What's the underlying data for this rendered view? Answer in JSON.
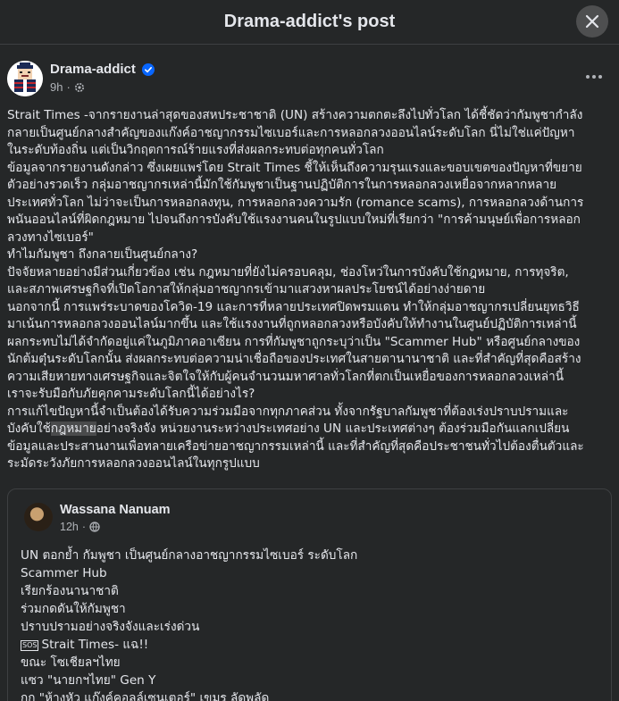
{
  "header": {
    "title": "Drama-addict's post"
  },
  "post": {
    "author": "Drama-addict",
    "time": "9h",
    "lines": [
      "Strait Times -จากรายงานล่าสุดของสหประชาชาติ (UN) สร้างความตกตะลึงไปทั่วโลก ได้ชี้ชัดว่ากัมพูชากำลัง",
      "กลายเป็นศูนย์กลางสำคัญของแก๊งค์อาชญากรรมไซเบอร์และการหลอกลวงออนไลน์ระดับโลก นี่ไม่ใช่แค่ปัญหา",
      "ในระดับท้องถิ่น แต่เป็นวิกฤตการณ์ร้ายแรงที่ส่งผลกระทบต่อทุกคนทั่วโลก",
      "ข้อมูลจากรายงานดังกล่าว ซึ่งเผยแพร่โดย Strait Times ชี้ให้เห็นถึงความรุนแรงและขอบเขตของปัญหาที่ขยาย",
      "ตัวอย่างรวดเร็ว กลุ่มอาชญากรเหล่านี้มักใช้กัมพูชาเป็นฐานปฏิบัติการในการหลอกลวงเหยื่อจากหลากหลาย",
      "ประเทศทั่วโลก ไม่ว่าจะเป็นการหลอกลงทุน, การหลอกลวงความรัก (romance scams), การหลอกลวงด้านการ",
      "พนันออนไลน์ที่ผิดกฎหมาย ไปจนถึงการบังคับใช้แรงงานคนในรูปแบบใหม่ที่เรียกว่า \"การค้ามนุษย์เพื่อการหลอก",
      "ลวงทางไซเบอร์\"",
      "ทำไมกัมพูชา ถึงกลายเป็นศูนย์กลาง?",
      "ปัจจัยหลายอย่างมีส่วนเกี่ยวข้อง เช่น กฎหมายที่ยังไม่ครอบคลุม, ช่องโหว่ในการบังคับใช้กฎหมาย, การทุจริต,",
      "และสภาพเศรษฐกิจที่เปิดโอกาสให้กลุ่มอาชญากรเข้ามาแสวงหาผลประโยชน์ได้อย่างง่ายดาย",
      "นอกจากนี้ การแพร่ระบาดของโควิด-19 และการที่หลายประเทศปิดพรมแดน ทำให้กลุ่มอาชญากรเปลี่ยนยุทธวิธี",
      "มาเน้นการหลอกลวงออนไลน์มากขึ้น และใช้แรงงานที่ถูกหลอกลวงหรือบังคับให้ทำงานในศูนย์ปฏิบัติการเหล่านี้",
      "ผลกระทบไม่ได้จำกัดอยู่แค่ในภูมิภาคอาเซียน การที่กัมพูชาถูกระบุว่าเป็น \"Scammer Hub\" หรือศูนย์กลางของ",
      "นักต้มตุ๋นระดับโลกนั้น ส่งผลกระทบต่อความน่าเชื่อถือของประเทศในสายตานานาชาติ และที่สำคัญที่สุดคือสร้าง",
      "ความเสียหายทางเศรษฐกิจและจิตใจให้กับผู้คนจำนวนมหาศาลทั่วโลกที่ตกเป็นเหยื่อของการหลอกลวงเหล่านี้",
      "เราจะรับมือกับภัยคุกคามระดับโลกนี้ได้อย่างไร?",
      "การแก้ไขปัญหานี้จำเป็นต้องได้รับความร่วมมือจากทุกภาคส่วน ทั้งจากรัฐบาลกัมพูชาที่ต้องเร่งปราบปรามและ"
    ],
    "line19_before": "บังคับใช้",
    "line19_highlight": "กฎหมาย",
    "line19_after": "อย่างจริงจัง หน่วยงานระหว่างประเทศอย่าง UN และประเทศต่างๆ ต้องร่วมมือกันแลกเปลี่ยน",
    "lines_end": [
      "ข้อมูลและประสานงานเพื่อทลายเครือข่ายอาชญากรรมเหล่านี้ และที่สำคัญที่สุดคือประชาชนทั่วไปต้องตื่นตัวและ",
      "ระมัดระวังภัยการหลอกลวงออนไลน์ในทุกรูปแบบ"
    ]
  },
  "shared_post": {
    "author": "Wassana Nanuam",
    "time": "12h",
    "lines": [
      "UN ตอกย้ำ กัมพูชา เป็นศูนย์กลางอาชญากรรมไซเบอร์ ระดับโลก",
      "Scammer Hub",
      "เรียกร้องนานาชาติ",
      "ร่วมกดดันให้กัมพูชา",
      "ปราบปรามอย่างจริงจังและเร่งด่วน"
    ],
    "emoji_text": "SOS",
    "line_strait": "Strait Times- แฉ!!",
    "lines_tail": [
      "ขณะ โซเชียลฯไทย",
      "แซว \"นายกฯไทย\" Gen Y",
      "กก \"ห้างหัว แก๊งค์คอลล์เซนเตอร์\" เขมร ลัดพลัด"
    ]
  },
  "colors": {
    "background": "#252728",
    "text": "#e4e6eb",
    "secondary_text": "#b0b3b8",
    "verified_badge": "#0866ff",
    "close_button": "#4e4f50"
  },
  "icons": [
    "close-icon",
    "verified-badge-icon",
    "audience-settings-icon",
    "globe-icon",
    "more-options-icon"
  ]
}
